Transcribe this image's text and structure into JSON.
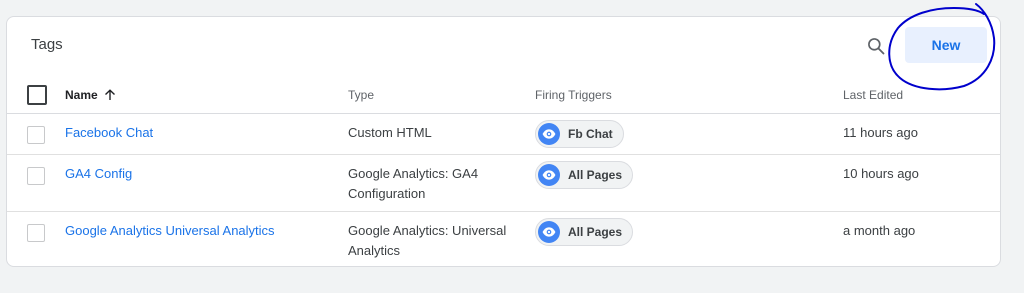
{
  "card": {
    "title": "Tags",
    "new_label": "New",
    "search_icon": "search-icon"
  },
  "columns": {
    "name": "Name",
    "sort_icon": "arrow-up-icon",
    "type": "Type",
    "triggers": "Firing Triggers",
    "last_edited": "Last Edited"
  },
  "rows": [
    {
      "name": "Facebook Chat",
      "type": "Custom HTML",
      "trigger": "Fb Chat",
      "trigger_icon": "eye-icon",
      "last_edited": "11 hours ago"
    },
    {
      "name": "GA4 Config",
      "type": "Google Analytics: GA4 Configuration",
      "trigger": "All Pages",
      "trigger_icon": "eye-icon",
      "last_edited": "10 hours ago"
    },
    {
      "name": "Google Analytics Universal Analytics",
      "type": "Google Analytics: Universal Analytics",
      "trigger": "All Pages",
      "trigger_icon": "eye-icon",
      "last_edited": "a month ago"
    }
  ],
  "colors": {
    "accent": "#1a73e8",
    "new_button_bg": "#e8f0fe",
    "trigger_icon_bg": "#4285f4",
    "annotation": "#0000cc"
  }
}
